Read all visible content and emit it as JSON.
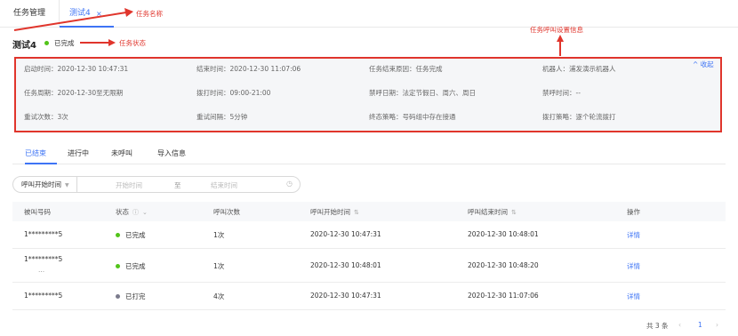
{
  "tabs": {
    "main": "任务管理",
    "active": "测试4",
    "close": "×"
  },
  "annotations": {
    "task_name": "任务名称",
    "task_status": "任务状态",
    "call_settings": "任务呼叫设置信息"
  },
  "task": {
    "title": "测试4",
    "status": "已完成"
  },
  "info": {
    "collapse": "^ 收起",
    "items": [
      "启动时间：2020-12-30 10:47:31",
      "结束时间：2020-12-30 11:07:06",
      "任务结束原因：任务完成",
      "机器人：浦发演示机器人",
      "任务周期：2020-12-30至无限期",
      "拨打时间：09:00-21:00",
      "禁呼日期：法定节假日、周六、周日",
      "禁呼时间：--",
      "重试次数：3次",
      "重试间隔：5分钟",
      "终态策略：号码组中存在接通",
      "拨打策略：逐个轮流拨打"
    ]
  },
  "subtabs": [
    "已结束",
    "进行中",
    "未呼叫",
    "导入信息"
  ],
  "filter": {
    "select": "呼叫开始时间",
    "start_placeholder": "开始时间",
    "separator": "至",
    "end_placeholder": "结束时间"
  },
  "table": {
    "headers": [
      "被叫号码",
      "状态",
      "呼叫次数",
      "呼叫开始时间",
      "呼叫结束时间",
      "操作"
    ],
    "rows": [
      {
        "number": "1*********5",
        "sub": "",
        "status": "已完成",
        "status_color": "#52c41a",
        "count": "1次",
        "start": "2020-12-30 10:47:31",
        "end": "2020-12-30 10:48:01",
        "action": "详情"
      },
      {
        "number": "1*********5",
        "sub": "...",
        "status": "已完成",
        "status_color": "#52c41a",
        "count": "1次",
        "start": "2020-12-30 10:48:01",
        "end": "2020-12-30 10:48:20",
        "action": "详情"
      },
      {
        "number": "1*********5",
        "sub": "",
        "status": "已打完",
        "status_color": "#7b7b8c",
        "count": "4次",
        "start": "2020-12-30 10:47:31",
        "end": "2020-12-30 11:07:06",
        "action": "详情"
      }
    ]
  },
  "pager": {
    "total": "共 3 条",
    "prev": "‹",
    "page": "1",
    "next": "›"
  },
  "colors": {
    "accent": "#3e74f5",
    "annotation": "#e0352c",
    "success": "#52c41a",
    "muted": "#7b7b8c"
  }
}
